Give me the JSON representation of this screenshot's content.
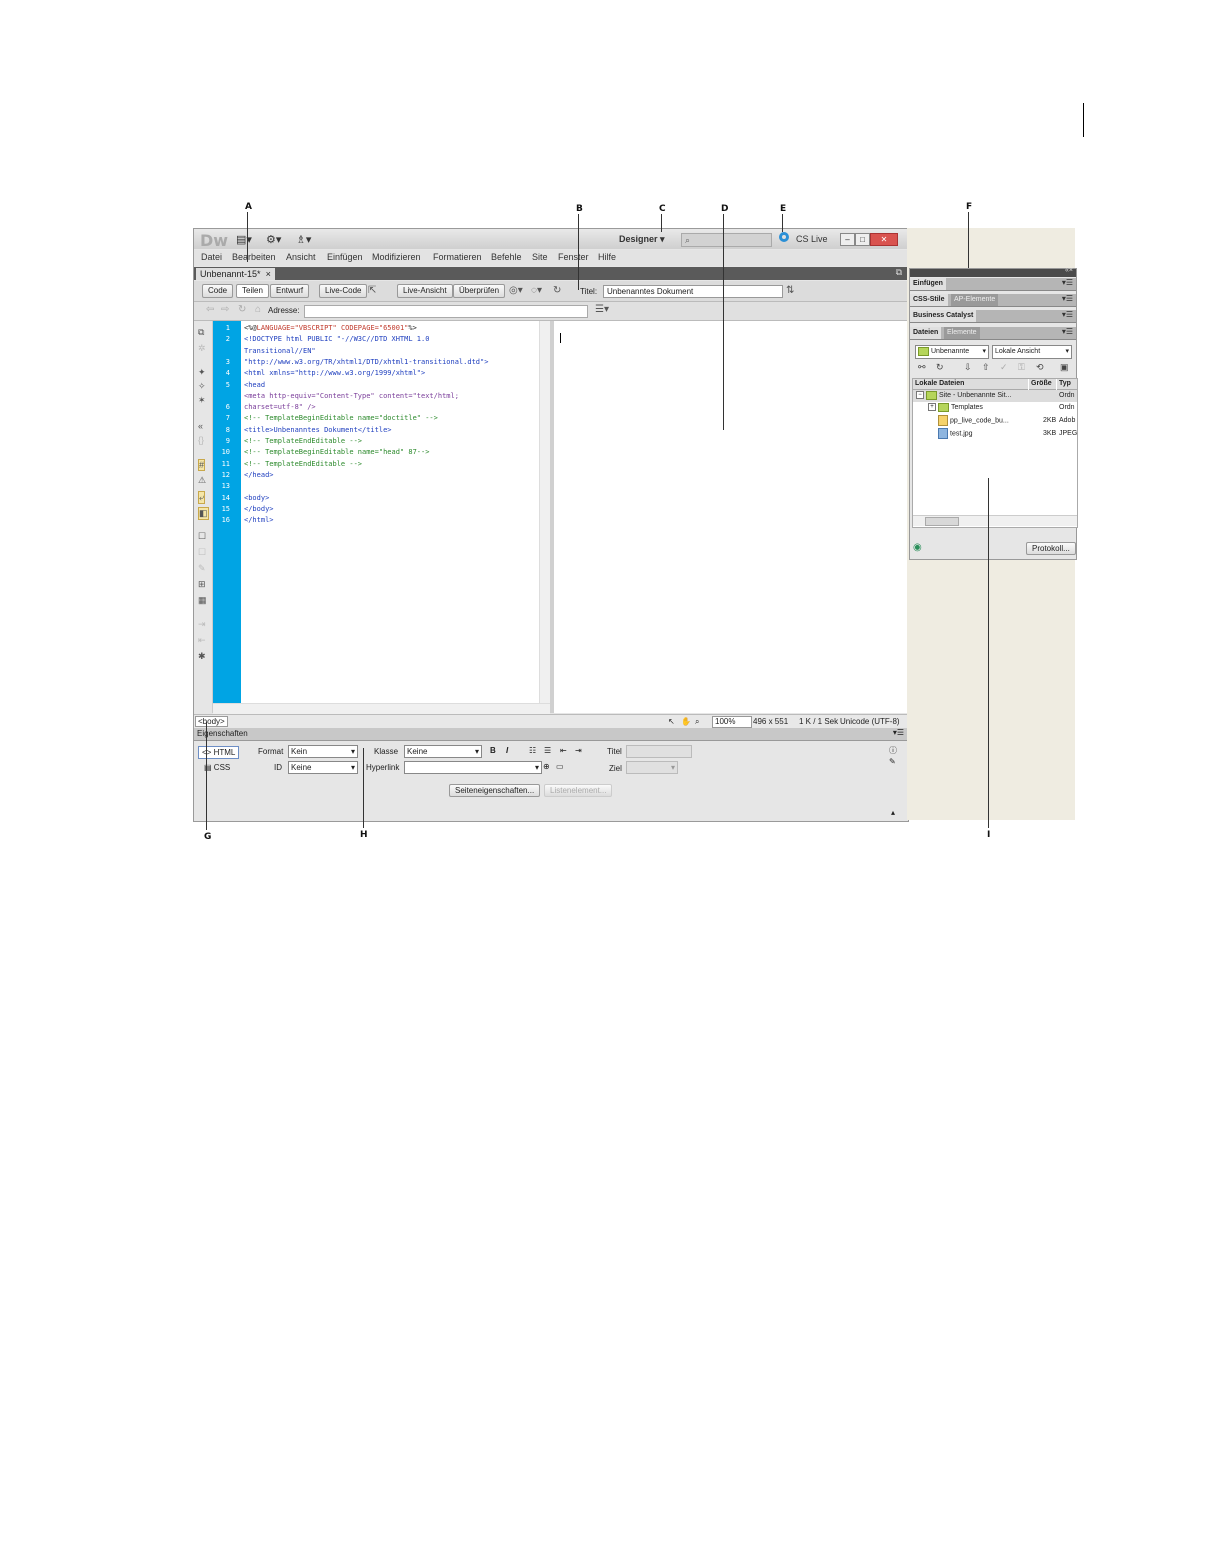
{
  "callouts": {
    "A": "A",
    "B": "B",
    "C": "C",
    "D": "D",
    "E": "E",
    "F": "F",
    "G": "G",
    "H": "H",
    "I": "I"
  },
  "app": {
    "logo": "Dw",
    "workspace": "Designer",
    "cslive": "CS Live",
    "menu": [
      "Datei",
      "Bearbeiten",
      "Ansicht",
      "Einfügen",
      "Modifizieren",
      "Formatieren",
      "Befehle",
      "Site",
      "Fenster",
      "Hilfe"
    ]
  },
  "document": {
    "tab": "Unbenannt-15*",
    "close": "×",
    "views": [
      "Code",
      "Teilen",
      "Entwurf"
    ],
    "live_code": "Live-Code",
    "live_view": "Live-Ansicht",
    "inspect": "Überprüfen",
    "title_label": "Titel:",
    "title_value": "Unbenanntes Dokument",
    "address_label": "Adresse:"
  },
  "code": {
    "line_numbers": [
      "1",
      "2",
      "",
      "3",
      "4",
      "5",
      "",
      "6",
      "7",
      "8",
      "9",
      "10",
      "11",
      "12",
      "13",
      "14",
      "15",
      "16"
    ],
    "lines": [
      [
        {
          "t": "<%@",
          "c": "#222"
        },
        {
          "t": "LANGUAGE=\"VBSCRIPT\" CODEPAGE=\"65001\"",
          "c": "#c0392b"
        },
        {
          "t": "%>",
          "c": "#222"
        }
      ],
      [
        {
          "t": "<!DOCTYPE html PUBLIC \"-//W3C//DTD XHTML 1.0",
          "c": "#1f3fbf"
        }
      ],
      [
        {
          "t": "Transitional//EN\"",
          "c": "#1f3fbf"
        }
      ],
      [
        {
          "t": "\"http://www.w3.org/TR/xhtml1/DTD/xhtml1-transitional.dtd\">",
          "c": "#1f3fbf"
        }
      ],
      [
        {
          "t": "<html xmlns=\"http://www.w3.org/1999/xhtml\">",
          "c": "#1f3fbf"
        }
      ],
      [
        {
          "t": "<head",
          "c": "#1f3fbf"
        }
      ],
      [
        {
          "t": "<meta http-equiv=\"Content-Type\" content=\"text/html;",
          "c": "#7a3d9a"
        }
      ],
      [
        {
          "t": "charset=utf-8\" />",
          "c": "#7a3d9a"
        }
      ],
      [
        {
          "t": "<!-- TemplateBeginEditable name=\"doctitle\" -->",
          "c": "#2c8a2c"
        }
      ],
      [
        {
          "t": "<title>Unbenanntes Dokument</title>",
          "c": "#1f3fbf"
        }
      ],
      [
        {
          "t": "<!-- TemplateEndEditable -->",
          "c": "#2c8a2c"
        }
      ],
      [
        {
          "t": "<!-- TemplateBeginEditable name=\"head\" 87-->",
          "c": "#2c8a2c"
        }
      ],
      [
        {
          "t": "<!-- TemplateEndEditable -->",
          "c": "#2c8a2c"
        }
      ],
      [
        {
          "t": "</head>",
          "c": "#1f3fbf"
        }
      ],
      [
        {
          "t": "",
          "c": "#222"
        }
      ],
      [
        {
          "t": "<body>",
          "c": "#1f3fbf"
        }
      ],
      [
        {
          "t": "</body>",
          "c": "#1f3fbf"
        }
      ],
      [
        {
          "t": "</html>",
          "c": "#1f3fbf"
        }
      ]
    ]
  },
  "status": {
    "tag": "<body>",
    "zoom": "100%",
    "dimensions": "496 x 551",
    "size_time": "1 K / 1 Sek",
    "encoding": "Unicode (UTF-8)"
  },
  "properties": {
    "title": "Eigenschaften",
    "html": "HTML",
    "css": "CSS",
    "format_label": "Format",
    "format_value": "Kein",
    "class_label": "Klasse",
    "class_value": "Keine",
    "id_label": "ID",
    "id_value": "Keine",
    "link_label": "Hyperlink",
    "title_label": "Titel",
    "target_label": "Ziel",
    "page_props": "Seiteneigenschaften...",
    "list_item": "Listenelement..."
  },
  "panels": {
    "insert": "Einfügen",
    "css_styles": "CSS-Stile",
    "ap_elements": "AP-Elemente",
    "business_catalyst": "Business Catalyst",
    "files_tab": "Dateien",
    "assets_tab": "Elemente",
    "site_select": "Unbenannte",
    "view_select": "Lokale Ansicht",
    "col_name": "Lokale Dateien",
    "col_size": "Größe",
    "col_type": "Typ",
    "files": [
      {
        "name": "Site - Unbenannte Sit...",
        "size": "",
        "type": "Ordn"
      },
      {
        "name": "Templates",
        "size": "",
        "type": "Ordn"
      },
      {
        "name": "pp_live_code_bu...",
        "size": "2KB",
        "type": "Adob"
      },
      {
        "name": "test.jpg",
        "size": "3KB",
        "type": "JPEG"
      }
    ],
    "log_button": "Protokoll..."
  }
}
